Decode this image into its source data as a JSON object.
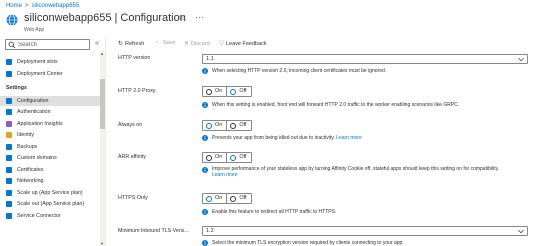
{
  "breadcrumb": {
    "home": "Home",
    "separator": ">",
    "app": "siliconwebapp655"
  },
  "header": {
    "title": "siliconwebapp655 | Configuration",
    "subtitle": "Web App",
    "star_icon": "star-icon",
    "more_label": "···"
  },
  "sidebar": {
    "search_placeholder": "Search",
    "collapse_label": "«",
    "items_top": [
      {
        "label": "Deployment slots",
        "icon": "slots-icon",
        "color": "#0078d4"
      },
      {
        "label": "Deployment Center",
        "icon": "deployment-center-icon",
        "color": "#0078d4"
      }
    ],
    "section_label": "Settings",
    "items": [
      {
        "label": "Configuration",
        "icon": "configuration-icon",
        "color": "#0078d4",
        "selected": true
      },
      {
        "label": "Authentication",
        "icon": "authentication-icon",
        "color": "#0078d4"
      },
      {
        "label": "Application Insights",
        "icon": "insights-icon",
        "color": "#8661c5"
      },
      {
        "label": "Identity",
        "icon": "identity-icon",
        "color": "#e3a21a"
      },
      {
        "label": "Backups",
        "icon": "backups-icon",
        "color": "#0078d4"
      },
      {
        "label": "Custom domains",
        "icon": "custom-domains-icon",
        "color": "#0078d4"
      },
      {
        "label": "Certificates",
        "icon": "certificates-icon",
        "color": "#0078d4"
      },
      {
        "label": "Networking",
        "icon": "networking-icon",
        "color": "#0078d4"
      },
      {
        "label": "Scale up (App Service plan)",
        "icon": "scale-up-icon",
        "color": "#0078d4"
      },
      {
        "label": "Scale out (App Service plan)",
        "icon": "scale-out-icon",
        "color": "#0078d4"
      },
      {
        "label": "Service Connector",
        "icon": "service-connector-icon",
        "color": "#0078d4"
      }
    ]
  },
  "toolbar": {
    "refresh": "Refresh",
    "save": "Save",
    "discard": "Discard",
    "feedback": "Leave Feedback"
  },
  "settings": {
    "http_version": {
      "label": "HTTP version",
      "value": "1.1",
      "info": "When selecting HTTP version 2.0, incoming client certificates must be ignored."
    },
    "http2_proxy": {
      "label": "HTTP 2.0 Proxy",
      "options": [
        "On",
        "Off"
      ],
      "selected": "Off",
      "info": "When this setting is enabled, front end will forward HTTP 2.0 traffic to the worker enabling scenarios like GRPC."
    },
    "always_on": {
      "label": "Always on",
      "options": [
        "On",
        "Off"
      ],
      "selected": "On",
      "info": "Prevents your app from being idled out due to inactivity.",
      "link": "Learn more"
    },
    "arr_affinity": {
      "label": "ARR affinity",
      "options": [
        "On",
        "Off"
      ],
      "selected": "Off",
      "info": "Improve performance of your stateless app by turning Affinity Cookie off, stateful apps should keep this setting on for compatibility.",
      "link": "Learn more"
    },
    "https_only": {
      "label": "HTTPS Only",
      "options": [
        "On",
        "Off"
      ],
      "selected": "On",
      "info": "Enable this feature to redirect all HTTP traffic to HTTPS."
    },
    "min_tls": {
      "label": "Minimum Inbound TLS Versi...",
      "value": "1.2",
      "info": "Select the minimum TLS encryption version required by clients connecting to your app."
    }
  },
  "colors": {
    "accent": "#0078d4",
    "selected_bg": "#e1dfdd",
    "text": "#323130",
    "muted": "#605e5c"
  }
}
